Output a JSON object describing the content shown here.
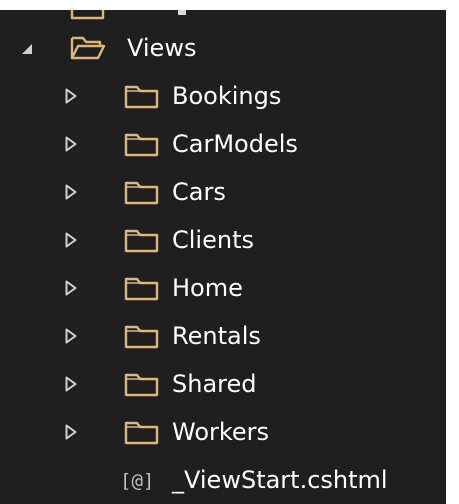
{
  "colors": {
    "panel_bg": "#1f1f1f",
    "folder_stroke": "#dcb67a",
    "text": "#ffffff",
    "chevron": "#d0d0d0",
    "file_icon": "#bfbfbf"
  },
  "tree": {
    "root": {
      "label": "Views",
      "expanded": true,
      "icon": "folder-open-icon"
    },
    "children": [
      {
        "label": "Bookings",
        "icon": "folder-icon",
        "expanded": false
      },
      {
        "label": "CarModels",
        "icon": "folder-icon",
        "expanded": false
      },
      {
        "label": "Cars",
        "icon": "folder-icon",
        "expanded": false
      },
      {
        "label": "Clients",
        "icon": "folder-icon",
        "expanded": false
      },
      {
        "label": "Home",
        "icon": "folder-icon",
        "expanded": false
      },
      {
        "label": "Rentals",
        "icon": "folder-icon",
        "expanded": false
      },
      {
        "label": "Shared",
        "icon": "folder-icon",
        "expanded": false
      },
      {
        "label": "Workers",
        "icon": "folder-icon",
        "expanded": false
      }
    ],
    "file": {
      "icon_text": "[@]",
      "label": "_ViewStart.cshtml",
      "icon": "razor-file-icon"
    }
  }
}
